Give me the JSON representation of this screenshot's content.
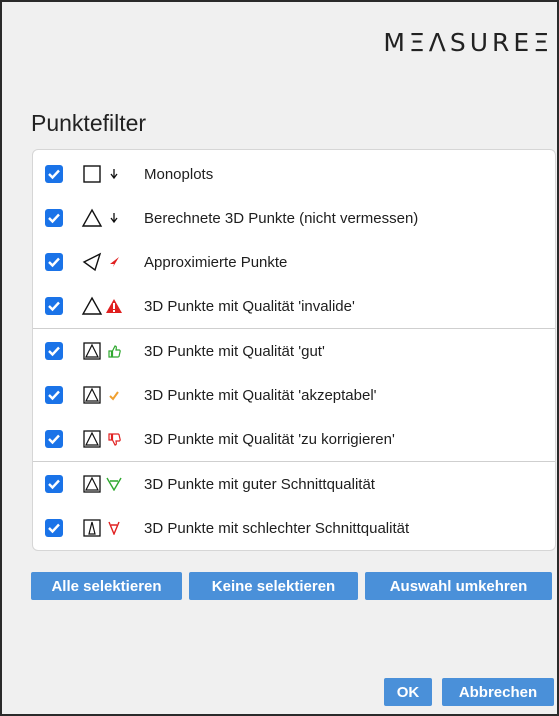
{
  "header": {
    "logo": "MΞΛSUREΞ",
    "title": "Punktefilter"
  },
  "filters": [
    {
      "label": "Monoplots",
      "checked": true,
      "symbol": "square-icon",
      "marker": "small-arrow-down-icon"
    },
    {
      "label": "Berechnete 3D Punkte (nicht vermessen)",
      "checked": true,
      "symbol": "triangle-icon",
      "marker": "small-arrow-down-icon"
    },
    {
      "label": "Approximierte Punkte",
      "checked": true,
      "symbol": "sideways-triangle-icon",
      "marker": "red-arrow-icon"
    },
    {
      "label": "3D Punkte mit Qualität 'invalide'",
      "checked": true,
      "symbol": "triangle-icon",
      "marker": "red-warning-icon"
    },
    {
      "label": "3D Punkte mit Qualität 'gut'",
      "checked": true,
      "symbol": "square-triangle-icon",
      "marker": "thumbs-up-icon"
    },
    {
      "label": "3D Punkte mit Qualität 'akzeptabel'",
      "checked": true,
      "symbol": "square-triangle-icon",
      "marker": "orange-check-icon"
    },
    {
      "label": "3D Punkte mit Qualität 'zu korrigieren'",
      "checked": true,
      "symbol": "square-triangle-icon",
      "marker": "thumbs-down-icon"
    },
    {
      "label": "3D Punkte mit guter Schnittqualität",
      "checked": true,
      "symbol": "square-triangle-icon",
      "marker": "green-triangle-icon"
    },
    {
      "label": "3D Punkte mit schlechter Schnittqualität",
      "checked": true,
      "symbol": "square-narrow-triangle-icon",
      "marker": "red-triangle-icon"
    }
  ],
  "actions": {
    "select_all": "Alle selektieren",
    "select_none": "Keine selektieren",
    "invert": "Auswahl umkehren"
  },
  "footer": {
    "ok": "OK",
    "cancel": "Abbrechen"
  },
  "colors": {
    "accent": "#4a90d9",
    "checkbox": "#1a73e8",
    "red": "#e02020",
    "green": "#2fa82f",
    "orange": "#f0a030"
  }
}
